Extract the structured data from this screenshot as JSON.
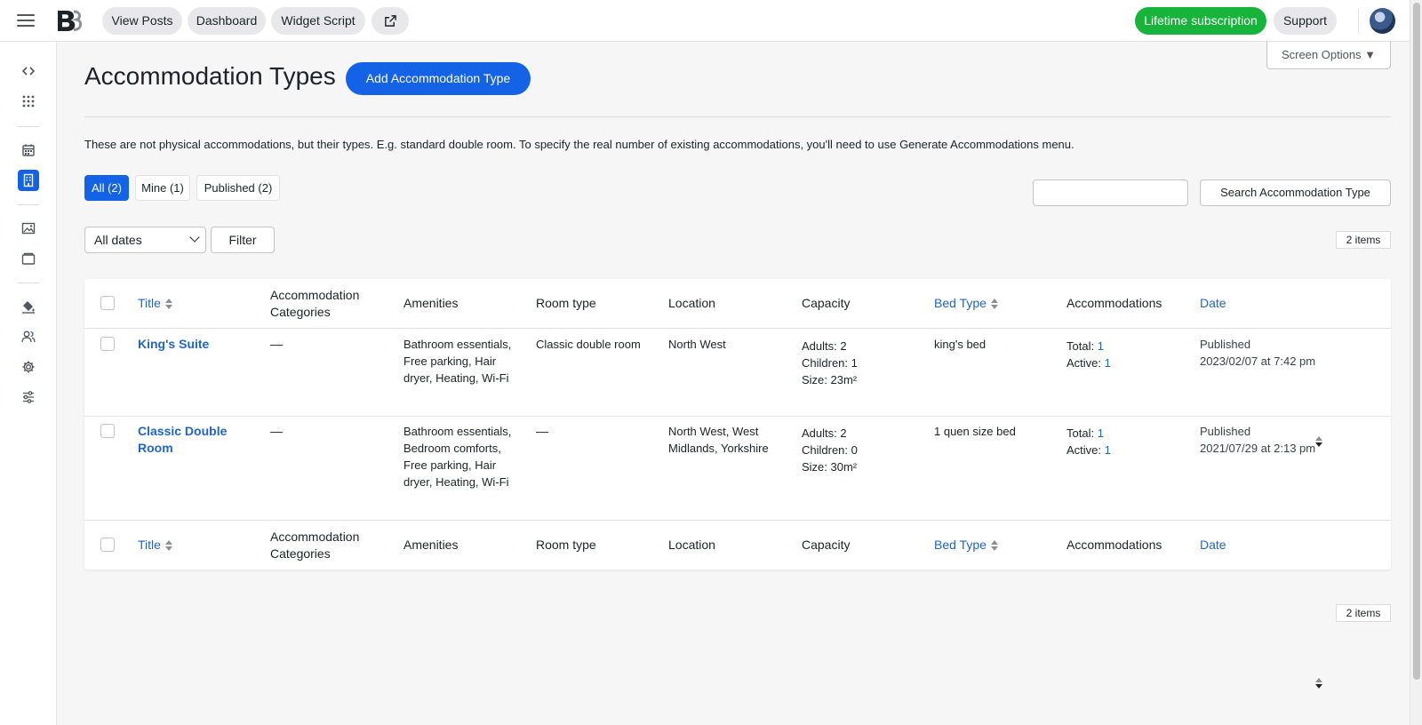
{
  "topbar": {
    "nav": [
      "View Posts",
      "Dashboard",
      "Widget Script"
    ],
    "subscription": "Lifetime subscription",
    "support": "Support"
  },
  "page": {
    "screen_options": "Screen Options ▼",
    "title": "Accommodation Types",
    "add_button": "Add Accommodation Type",
    "description": "These are not physical accommodations, but their types. E.g. standard double room. To specify the real number of existing accommodations, you'll need to use Generate Accommodations menu.",
    "views": [
      "All (2)",
      "Mine (1)",
      "Published (2)"
    ],
    "search_button": "Search Accommodation Type",
    "date_filter": "All dates",
    "filter_button": "Filter",
    "items_count": "2 items"
  },
  "table": {
    "headers": [
      "Title",
      "Accommodation Categories",
      "Amenities",
      "Room type",
      "Location",
      "Capacity",
      "Bed Type",
      "Accommodations",
      "Date"
    ],
    "rows": [
      {
        "title": "King's Suite",
        "categories": "—",
        "amenities": "Bathroom essentials, Free parking, Hair dryer, Heating, Wi-Fi",
        "room_type": "Classic double room",
        "location": "North West",
        "adults": "Adults: 2",
        "children": "Children: 1",
        "size": "Size:  23m²",
        "bed_type": "king's bed",
        "total_label": "Total:",
        "total": "1",
        "active_label": "Active:",
        "active": "1",
        "status": "Published",
        "date": "2023/02/07 at 7:42 pm"
      },
      {
        "title": "Classic Double Room",
        "categories": "—",
        "amenities": "Bathroom essentials, Bedroom comforts, Free parking, Hair dryer, Heating, Wi-Fi",
        "room_type": "—",
        "location": "North West, West Midlands, Yorkshire",
        "adults": "Adults: 2",
        "children": "Children: 0",
        "size": "Size:  30m²",
        "bed_type": "1 quen size bed",
        "total_label": "Total:",
        "total": "1",
        "active_label": "Active:",
        "active": "1",
        "status": "Published",
        "date": "2021/07/29 at 2:13 pm"
      }
    ]
  },
  "colors": {
    "primary": "#1463e6",
    "link": "#1e66c9",
    "success": "#17b43a"
  }
}
